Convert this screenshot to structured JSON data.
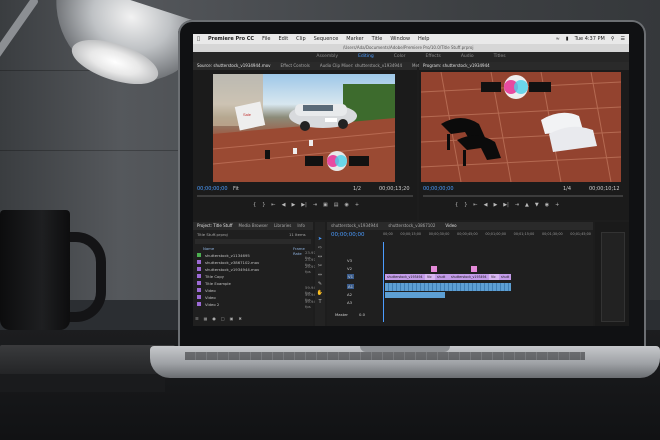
{
  "app": {
    "name": "Premiere Pro CC",
    "menus": [
      "File",
      "Edit",
      "Clip",
      "Sequence",
      "Marker",
      "Title",
      "Window",
      "Help"
    ],
    "clock": "Tue 4:37 PM",
    "window_path": "/Users/Ada/Documents/Adobe/Premiere Pro/10.0/Title Stuff.prproj"
  },
  "workspaces": [
    "Assembly",
    "Editing",
    "Color",
    "Effects",
    "Audio",
    "Titles"
  ],
  "active_workspace": "Editing",
  "source_panel": {
    "tabs": [
      "Source: shutterstock_v1934944.mov",
      "Effect Controls",
      "Audio Clip Mixer: shutterstock_v1934944",
      "Metadata"
    ],
    "timecode_in": "00;00;00;00",
    "fit": "Fit",
    "fraction": "1/2",
    "timecode_out": "00;00;13;20"
  },
  "program_panel": {
    "tabs": [
      "Program: shutterstock_v1934944"
    ],
    "timecode_in": "00;00;00;00",
    "fraction": "1/4",
    "timecode_out": "00;00;10;12"
  },
  "project_panel": {
    "tabs": [
      "Project: Title Stuff",
      "Media Browser",
      "Libraries",
      "Info"
    ],
    "file": "Title Stuff.prproj",
    "item_count": "11 Items",
    "column_name": "Name",
    "column_rate": "Frame Rate",
    "items": [
      {
        "name": "shutterstock_v1134695",
        "rate": "23.976 fps",
        "color": "#4caf50"
      },
      {
        "name": "shutterstock_v3867102.mov",
        "rate": "23.976 fps",
        "color": "#9c6ad6"
      },
      {
        "name": "shutterstock_v1934944.mov",
        "rate": "29.97 fps",
        "color": "#9c6ad6"
      },
      {
        "name": "Title Copy",
        "rate": "",
        "color": "#9c6ad6"
      },
      {
        "name": "Title Example",
        "rate": "",
        "color": "#9c6ad6"
      },
      {
        "name": "Video",
        "rate": "59.94 fps",
        "color": "#9c6ad6"
      },
      {
        "name": "Video",
        "rate": "59.94 fps",
        "color": "#9c6ad6"
      },
      {
        "name": "Video 2",
        "rate": "59.94 fps",
        "color": "#9c6ad6"
      }
    ]
  },
  "timeline_panel": {
    "tabs": [
      "shutterstock_v1934944",
      "shutterstock_v3867102",
      "Video"
    ],
    "timecode": "00;00;00;00",
    "ruler": [
      "00;00",
      "00;00;15;00",
      "00;00;30;00",
      "00;00;45;00",
      "00;01;00;00",
      "00;01;15;00",
      "00;01;30;00",
      "00;01;45;00"
    ],
    "tracks": [
      "V3",
      "V2",
      "V1",
      "A1",
      "A2",
      "A3",
      "Master"
    ],
    "master_level": "0.0",
    "clips": [
      {
        "label": "shutterstock_v193494",
        "track": "V1",
        "color": "#c29be8"
      },
      {
        "label": "Vic",
        "track": "V1",
        "color": "#c29be8"
      },
      {
        "label": "shutt",
        "track": "V1",
        "color": "#c29be8"
      },
      {
        "label": "shutterstock_v193494",
        "track": "V1",
        "color": "#c29be8"
      },
      {
        "label": "Vic",
        "track": "V1",
        "color": "#c29be8"
      },
      {
        "label": "shutt",
        "track": "V1",
        "color": "#c29be8"
      }
    ]
  },
  "colors": {
    "accent": "#4b9cff",
    "panel": "#1d1d1d",
    "clip_video": "#c29be8",
    "clip_audio": "#5d9fd3"
  }
}
